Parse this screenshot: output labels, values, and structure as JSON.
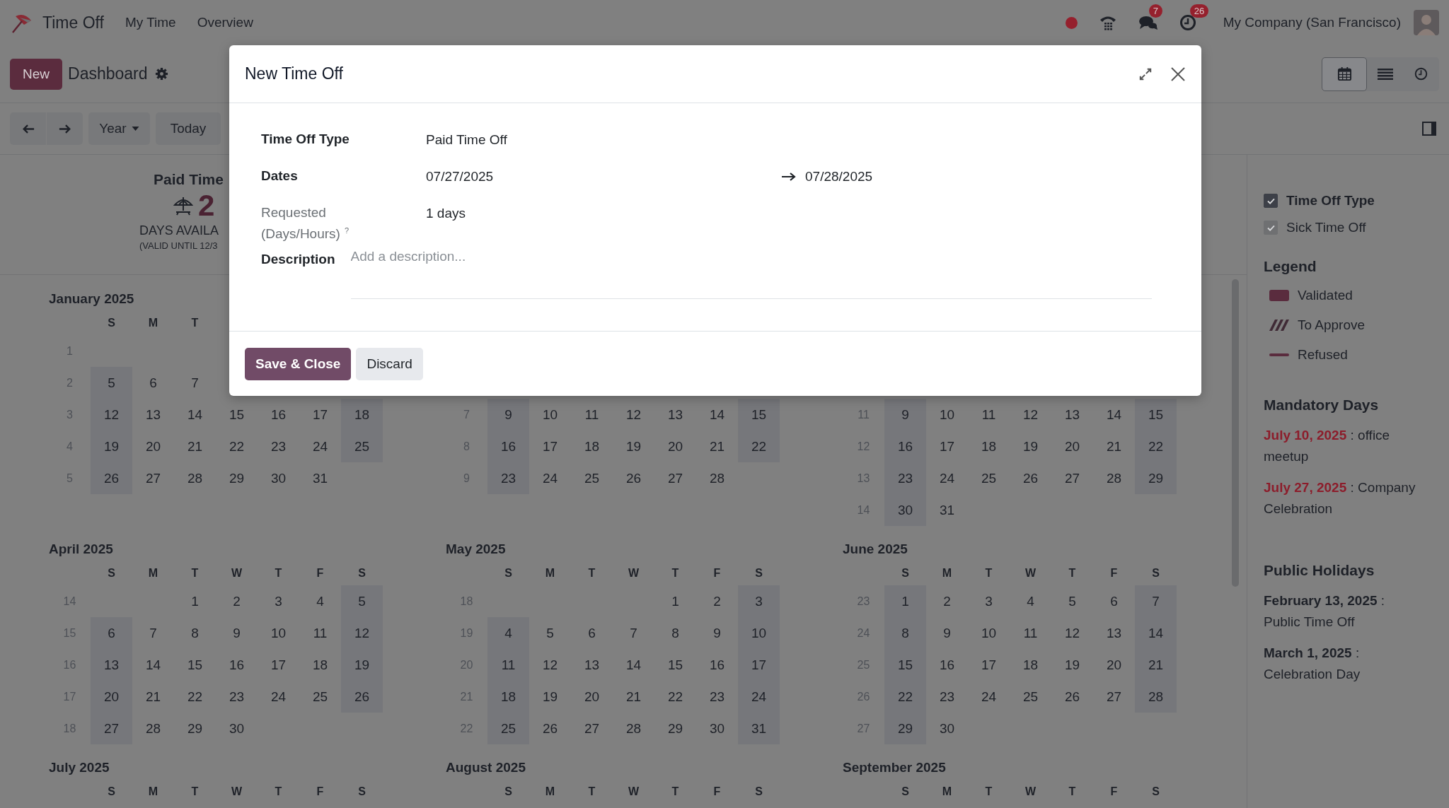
{
  "navbar": {
    "app_name": "Time Off",
    "menu": [
      {
        "label": "My Time"
      },
      {
        "label": "Overview"
      }
    ],
    "systray": [
      {
        "kind": "status"
      },
      {
        "kind": "phone"
      },
      {
        "kind": "chat",
        "badge": "7"
      },
      {
        "kind": "activity",
        "badge": "26"
      }
    ],
    "company": "My Company (San Francisco)"
  },
  "control_panel": {
    "new_button": "New",
    "breadcrumb": "Dashboard",
    "period": "Year",
    "today": "Today",
    "views": [
      {
        "kind": "calendar",
        "selected": true
      },
      {
        "kind": "list",
        "selected": false
      },
      {
        "kind": "activity",
        "selected": false
      }
    ]
  },
  "summary": {
    "title": "Paid Time",
    "value": "2",
    "caption": "DAYS AVAILA",
    "validity": "(VALID UNTIL 12/3"
  },
  "calendar": {
    "months": [
      {
        "title": "January 2025",
        "weekdays": [
          {
            "kind": "label",
            "label": "S"
          },
          {
            "kind": "label",
            "label": "M"
          },
          {
            "kind": "label",
            "label": "T"
          },
          {
            "kind": "blank"
          },
          {
            "kind": "blank"
          },
          {
            "kind": "blank"
          },
          {
            "kind": "blank"
          }
        ],
        "weeks": [
          {
            "kind": "week",
            "number": "1"
          },
          {
            "kind": "week",
            "number": "2",
            "days": [
              {
                "kind": "day",
                "label": "5"
              },
              {
                "kind": "day",
                "label": "6"
              },
              {
                "kind": "day",
                "label": "7"
              }
            ]
          },
          {
            "kind": "week",
            "number": "3",
            "days": [
              {
                "kind": "day",
                "label": "12"
              },
              {
                "kind": "day",
                "label": "13"
              },
              {
                "kind": "day",
                "label": "14"
              },
              {
                "kind": "day",
                "label": "15"
              },
              {
                "kind": "day",
                "label": "16"
              },
              {
                "kind": "day",
                "label": "17"
              },
              {
                "kind": "day",
                "label": "18"
              }
            ]
          },
          {
            "kind": "week",
            "number": "4",
            "days": [
              {
                "kind": "day",
                "label": "19"
              },
              {
                "kind": "day",
                "label": "20"
              },
              {
                "kind": "day",
                "label": "21"
              },
              {
                "kind": "day",
                "label": "22"
              },
              {
                "kind": "day",
                "label": "23"
              },
              {
                "kind": "day",
                "label": "24"
              },
              {
                "kind": "day",
                "label": "25"
              }
            ]
          },
          {
            "kind": "week",
            "number": "5",
            "days": [
              {
                "kind": "day",
                "label": "26"
              },
              {
                "kind": "day",
                "label": "27"
              },
              {
                "kind": "day",
                "label": "28"
              },
              {
                "kind": "day",
                "label": "29"
              },
              {
                "kind": "day",
                "label": "30"
              },
              {
                "kind": "day",
                "label": "31"
              }
            ]
          }
        ]
      },
      {
        "weeks": [
          {
            "kind": "blank"
          },
          {
            "kind": "blank"
          },
          {
            "kind": "week",
            "number": "7",
            "days": [
              {
                "kind": "day",
                "label": "9"
              },
              {
                "kind": "day",
                "label": "10"
              },
              {
                "kind": "day",
                "label": "11"
              },
              {
                "kind": "day",
                "label": "12"
              },
              {
                "kind": "day",
                "label": "13"
              },
              {
                "kind": "day",
                "label": "14"
              },
              {
                "kind": "day",
                "label": "15"
              }
            ]
          },
          {
            "kind": "week",
            "number": "8",
            "days": [
              {
                "kind": "day",
                "label": "16"
              },
              {
                "kind": "day",
                "label": "17"
              },
              {
                "kind": "day",
                "label": "18"
              },
              {
                "kind": "day",
                "label": "19"
              },
              {
                "kind": "day",
                "label": "20"
              },
              {
                "kind": "day",
                "label": "21"
              },
              {
                "kind": "day",
                "label": "22"
              }
            ]
          },
          {
            "kind": "week",
            "number": "9",
            "days": [
              {
                "kind": "day",
                "label": "23"
              },
              {
                "kind": "day",
                "label": "24"
              },
              {
                "kind": "day",
                "label": "25"
              },
              {
                "kind": "day",
                "label": "26"
              },
              {
                "kind": "day",
                "label": "27"
              },
              {
                "kind": "day",
                "label": "28"
              }
            ]
          }
        ]
      },
      {
        "weeks": [
          {
            "kind": "blank"
          },
          {
            "kind": "blank"
          },
          {
            "kind": "week",
            "number": "11",
            "days": [
              {
                "kind": "day",
                "label": "9"
              },
              {
                "kind": "day",
                "label": "10"
              },
              {
                "kind": "day",
                "label": "11"
              },
              {
                "kind": "day",
                "label": "12"
              },
              {
                "kind": "day",
                "label": "13"
              },
              {
                "kind": "day",
                "label": "14"
              },
              {
                "kind": "day",
                "label": "15"
              }
            ]
          },
          {
            "kind": "week",
            "number": "12",
            "days": [
              {
                "kind": "day",
                "label": "16"
              },
              {
                "kind": "day",
                "label": "17"
              },
              {
                "kind": "day",
                "label": "18"
              },
              {
                "kind": "day",
                "label": "19"
              },
              {
                "kind": "day",
                "label": "20"
              },
              {
                "kind": "day",
                "label": "21"
              },
              {
                "kind": "day",
                "label": "22"
              }
            ]
          },
          {
            "kind": "week",
            "number": "13",
            "days": [
              {
                "kind": "day",
                "label": "23"
              },
              {
                "kind": "day",
                "label": "24"
              },
              {
                "kind": "day",
                "label": "25"
              },
              {
                "kind": "day",
                "label": "26"
              },
              {
                "kind": "day",
                "label": "27"
              },
              {
                "kind": "day",
                "label": "28"
              },
              {
                "kind": "day",
                "label": "29"
              }
            ]
          },
          {
            "kind": "week",
            "number": "14",
            "days": [
              {
                "kind": "day",
                "label": "30"
              },
              {
                "kind": "day",
                "label": "31"
              }
            ]
          }
        ]
      },
      {
        "title": "April 2025",
        "weekdays": [
          {
            "kind": "label",
            "label": "S"
          },
          {
            "kind": "label",
            "label": "M"
          },
          {
            "kind": "label",
            "label": "T"
          },
          {
            "kind": "label",
            "label": "W"
          },
          {
            "kind": "label",
            "label": "T"
          },
          {
            "kind": "label",
            "label": "F"
          },
          {
            "kind": "label",
            "label": "S"
          }
        ],
        "weeks": [
          {
            "kind": "week",
            "number": "14",
            "days": [
              {
                "kind": "blank"
              },
              {
                "kind": "blank"
              },
              {
                "kind": "day",
                "label": "1"
              },
              {
                "kind": "day",
                "label": "2"
              },
              {
                "kind": "day",
                "label": "3"
              },
              {
                "kind": "day",
                "label": "4"
              },
              {
                "kind": "day",
                "label": "5"
              }
            ]
          },
          {
            "kind": "week",
            "number": "15",
            "days": [
              {
                "kind": "day",
                "label": "6"
              },
              {
                "kind": "day",
                "label": "7"
              },
              {
                "kind": "day",
                "label": "8"
              },
              {
                "kind": "day",
                "label": "9"
              },
              {
                "kind": "day",
                "label": "10"
              },
              {
                "kind": "day",
                "label": "11"
              },
              {
                "kind": "day",
                "label": "12"
              }
            ]
          },
          {
            "kind": "week",
            "number": "16",
            "days": [
              {
                "kind": "day",
                "label": "13"
              },
              {
                "kind": "day",
                "label": "14"
              },
              {
                "kind": "day",
                "label": "15"
              },
              {
                "kind": "day",
                "label": "16"
              },
              {
                "kind": "day",
                "label": "17"
              },
              {
                "kind": "day",
                "label": "18"
              },
              {
                "kind": "day",
                "label": "19"
              }
            ]
          },
          {
            "kind": "week",
            "number": "17",
            "days": [
              {
                "kind": "day",
                "label": "20"
              },
              {
                "kind": "day",
                "label": "21"
              },
              {
                "kind": "day",
                "label": "22"
              },
              {
                "kind": "day",
                "label": "23"
              },
              {
                "kind": "day",
                "label": "24"
              },
              {
                "kind": "day",
                "label": "25"
              },
              {
                "kind": "day",
                "label": "26"
              }
            ]
          },
          {
            "kind": "week",
            "number": "18",
            "days": [
              {
                "kind": "day",
                "label": "27"
              },
              {
                "kind": "day",
                "label": "28"
              },
              {
                "kind": "day",
                "label": "29"
              },
              {
                "kind": "day",
                "label": "30"
              }
            ]
          }
        ]
      },
      {
        "title": "May 2025",
        "weekdays": [
          {
            "kind": "label",
            "label": "S"
          },
          {
            "kind": "label",
            "label": "M"
          },
          {
            "kind": "label",
            "label": "T"
          },
          {
            "kind": "label",
            "label": "W"
          },
          {
            "kind": "label",
            "label": "T"
          },
          {
            "kind": "label",
            "label": "F"
          },
          {
            "kind": "label",
            "label": "S"
          }
        ],
        "weeks": [
          {
            "kind": "week",
            "number": "18",
            "days": [
              {
                "kind": "blank"
              },
              {
                "kind": "blank"
              },
              {
                "kind": "blank"
              },
              {
                "kind": "blank"
              },
              {
                "kind": "day",
                "label": "1"
              },
              {
                "kind": "day",
                "label": "2"
              },
              {
                "kind": "day",
                "label": "3"
              }
            ]
          },
          {
            "kind": "week",
            "number": "19",
            "days": [
              {
                "kind": "day",
                "label": "4"
              },
              {
                "kind": "day",
                "label": "5"
              },
              {
                "kind": "day",
                "label": "6"
              },
              {
                "kind": "day",
                "label": "7"
              },
              {
                "kind": "day",
                "label": "8"
              },
              {
                "kind": "day",
                "label": "9"
              },
              {
                "kind": "day",
                "label": "10"
              }
            ]
          },
          {
            "kind": "week",
            "number": "20",
            "days": [
              {
                "kind": "day",
                "label": "11"
              },
              {
                "kind": "day",
                "label": "12"
              },
              {
                "kind": "day",
                "label": "13"
              },
              {
                "kind": "day",
                "label": "14"
              },
              {
                "kind": "day",
                "label": "15"
              },
              {
                "kind": "day",
                "label": "16"
              },
              {
                "kind": "day",
                "label": "17"
              }
            ]
          },
          {
            "kind": "week",
            "number": "21",
            "days": [
              {
                "kind": "day",
                "label": "18"
              },
              {
                "kind": "day",
                "label": "19"
              },
              {
                "kind": "day",
                "label": "20"
              },
              {
                "kind": "day",
                "label": "21"
              },
              {
                "kind": "day",
                "label": "22"
              },
              {
                "kind": "day",
                "label": "23"
              },
              {
                "kind": "day",
                "label": "24"
              }
            ]
          },
          {
            "kind": "week",
            "number": "22",
            "days": [
              {
                "kind": "day",
                "label": "25"
              },
              {
                "kind": "day",
                "label": "26"
              },
              {
                "kind": "day",
                "label": "27"
              },
              {
                "kind": "day",
                "label": "28"
              },
              {
                "kind": "day",
                "label": "29"
              },
              {
                "kind": "day",
                "label": "30"
              },
              {
                "kind": "day",
                "label": "31"
              }
            ]
          }
        ]
      },
      {
        "title": "June 2025",
        "weekdays": [
          {
            "kind": "label",
            "label": "S"
          },
          {
            "kind": "label",
            "label": "M"
          },
          {
            "kind": "label",
            "label": "T"
          },
          {
            "kind": "label",
            "label": "W"
          },
          {
            "kind": "label",
            "label": "T"
          },
          {
            "kind": "label",
            "label": "F"
          },
          {
            "kind": "label",
            "label": "S"
          }
        ],
        "weeks": [
          {
            "kind": "week",
            "number": "23",
            "days": [
              {
                "kind": "day",
                "label": "1"
              },
              {
                "kind": "day",
                "label": "2"
              },
              {
                "kind": "day",
                "label": "3"
              },
              {
                "kind": "day",
                "label": "4"
              },
              {
                "kind": "day",
                "label": "5"
              },
              {
                "kind": "day",
                "label": "6"
              },
              {
                "kind": "day",
                "label": "7"
              }
            ]
          },
          {
            "kind": "week",
            "number": "24",
            "days": [
              {
                "kind": "day",
                "label": "8"
              },
              {
                "kind": "day",
                "label": "9"
              },
              {
                "kind": "day",
                "label": "10"
              },
              {
                "kind": "day",
                "label": "11"
              },
              {
                "kind": "day",
                "label": "12"
              },
              {
                "kind": "day",
                "label": "13"
              },
              {
                "kind": "day",
                "label": "14"
              }
            ]
          },
          {
            "kind": "week",
            "number": "25",
            "days": [
              {
                "kind": "day",
                "label": "15"
              },
              {
                "kind": "day",
                "label": "16"
              },
              {
                "kind": "day",
                "label": "17"
              },
              {
                "kind": "day",
                "label": "18"
              },
              {
                "kind": "day",
                "label": "19"
              },
              {
                "kind": "day",
                "label": "20"
              },
              {
                "kind": "day",
                "label": "21"
              }
            ]
          },
          {
            "kind": "week",
            "number": "26",
            "days": [
              {
                "kind": "day",
                "label": "22"
              },
              {
                "kind": "day",
                "label": "23"
              },
              {
                "kind": "day",
                "label": "24"
              },
              {
                "kind": "day",
                "label": "25"
              },
              {
                "kind": "day",
                "label": "26"
              },
              {
                "kind": "day",
                "label": "27"
              },
              {
                "kind": "day",
                "label": "28"
              }
            ]
          },
          {
            "kind": "week",
            "number": "27",
            "days": [
              {
                "kind": "day",
                "label": "29"
              },
              {
                "kind": "day",
                "label": "30"
              }
            ]
          }
        ]
      },
      {
        "title": "July 2025",
        "weekdays": [
          {
            "kind": "label",
            "label": "S"
          },
          {
            "kind": "label",
            "label": "M"
          },
          {
            "kind": "label",
            "label": "T"
          },
          {
            "kind": "label",
            "label": "W"
          },
          {
            "kind": "label",
            "label": "T"
          },
          {
            "kind": "label",
            "label": "F"
          },
          {
            "kind": "label",
            "label": "S"
          }
        ]
      },
      {
        "title": "August 2025",
        "weekdays": [
          {
            "kind": "label",
            "label": "S"
          },
          {
            "kind": "label",
            "label": "M"
          },
          {
            "kind": "label",
            "label": "T"
          },
          {
            "kind": "label",
            "label": "W"
          },
          {
            "kind": "label",
            "label": "T"
          },
          {
            "kind": "label",
            "label": "F"
          },
          {
            "kind": "label",
            "label": "S"
          }
        ]
      },
      {
        "title": "September 2025",
        "weekdays": [
          {
            "kind": "label",
            "label": "S"
          },
          {
            "kind": "label",
            "label": "M"
          },
          {
            "kind": "label",
            "label": "T"
          },
          {
            "kind": "label",
            "label": "W"
          },
          {
            "kind": "label",
            "label": "T"
          },
          {
            "kind": "label",
            "label": "F"
          },
          {
            "kind": "label",
            "label": "S"
          }
        ]
      }
    ]
  },
  "sidebar": {
    "filters": [
      {
        "kind": "group",
        "label": "Time Off Type",
        "checked": true
      },
      {
        "kind": "item",
        "label": "Sick Time Off",
        "checked": true
      }
    ],
    "legend_title": "Legend",
    "legend": [
      {
        "kind": "validated",
        "label": "Validated"
      },
      {
        "kind": "to_approve",
        "label": "To Approve"
      },
      {
        "kind": "refused",
        "label": "Refused"
      }
    ],
    "mandatory_title": "Mandatory Days",
    "mandatory_days": [
      "**July 10, 2025** : office meetup",
      "**July 27, 2025** : Company Celebration"
    ],
    "holidays_title": "Public Holidays",
    "public_holidays": [
      "**February 13, 2025** : Public Time Off",
      "**March 1, 2025** : Celebration Day"
    ]
  },
  "dialog": {
    "title": "New Time Off",
    "fields": [
      {
        "kind": "text",
        "label": "Time Off Type",
        "value": "Paid Time Off",
        "muted": false
      },
      {
        "kind": "range",
        "label": "Dates",
        "start": "07/27/2025",
        "end": "07/28/2025",
        "muted": false
      },
      {
        "kind": "text",
        "label": "Requested (Days/Hours)",
        "help": "?",
        "value": "1 days",
        "muted": true
      },
      {
        "kind": "textarea",
        "label": "Description",
        "placeholder": "Add a description...",
        "muted": false
      }
    ],
    "buttons": [
      {
        "kind": "primary",
        "label": "Save & Close"
      },
      {
        "kind": "secondary",
        "label": "Discard"
      }
    ]
  }
}
